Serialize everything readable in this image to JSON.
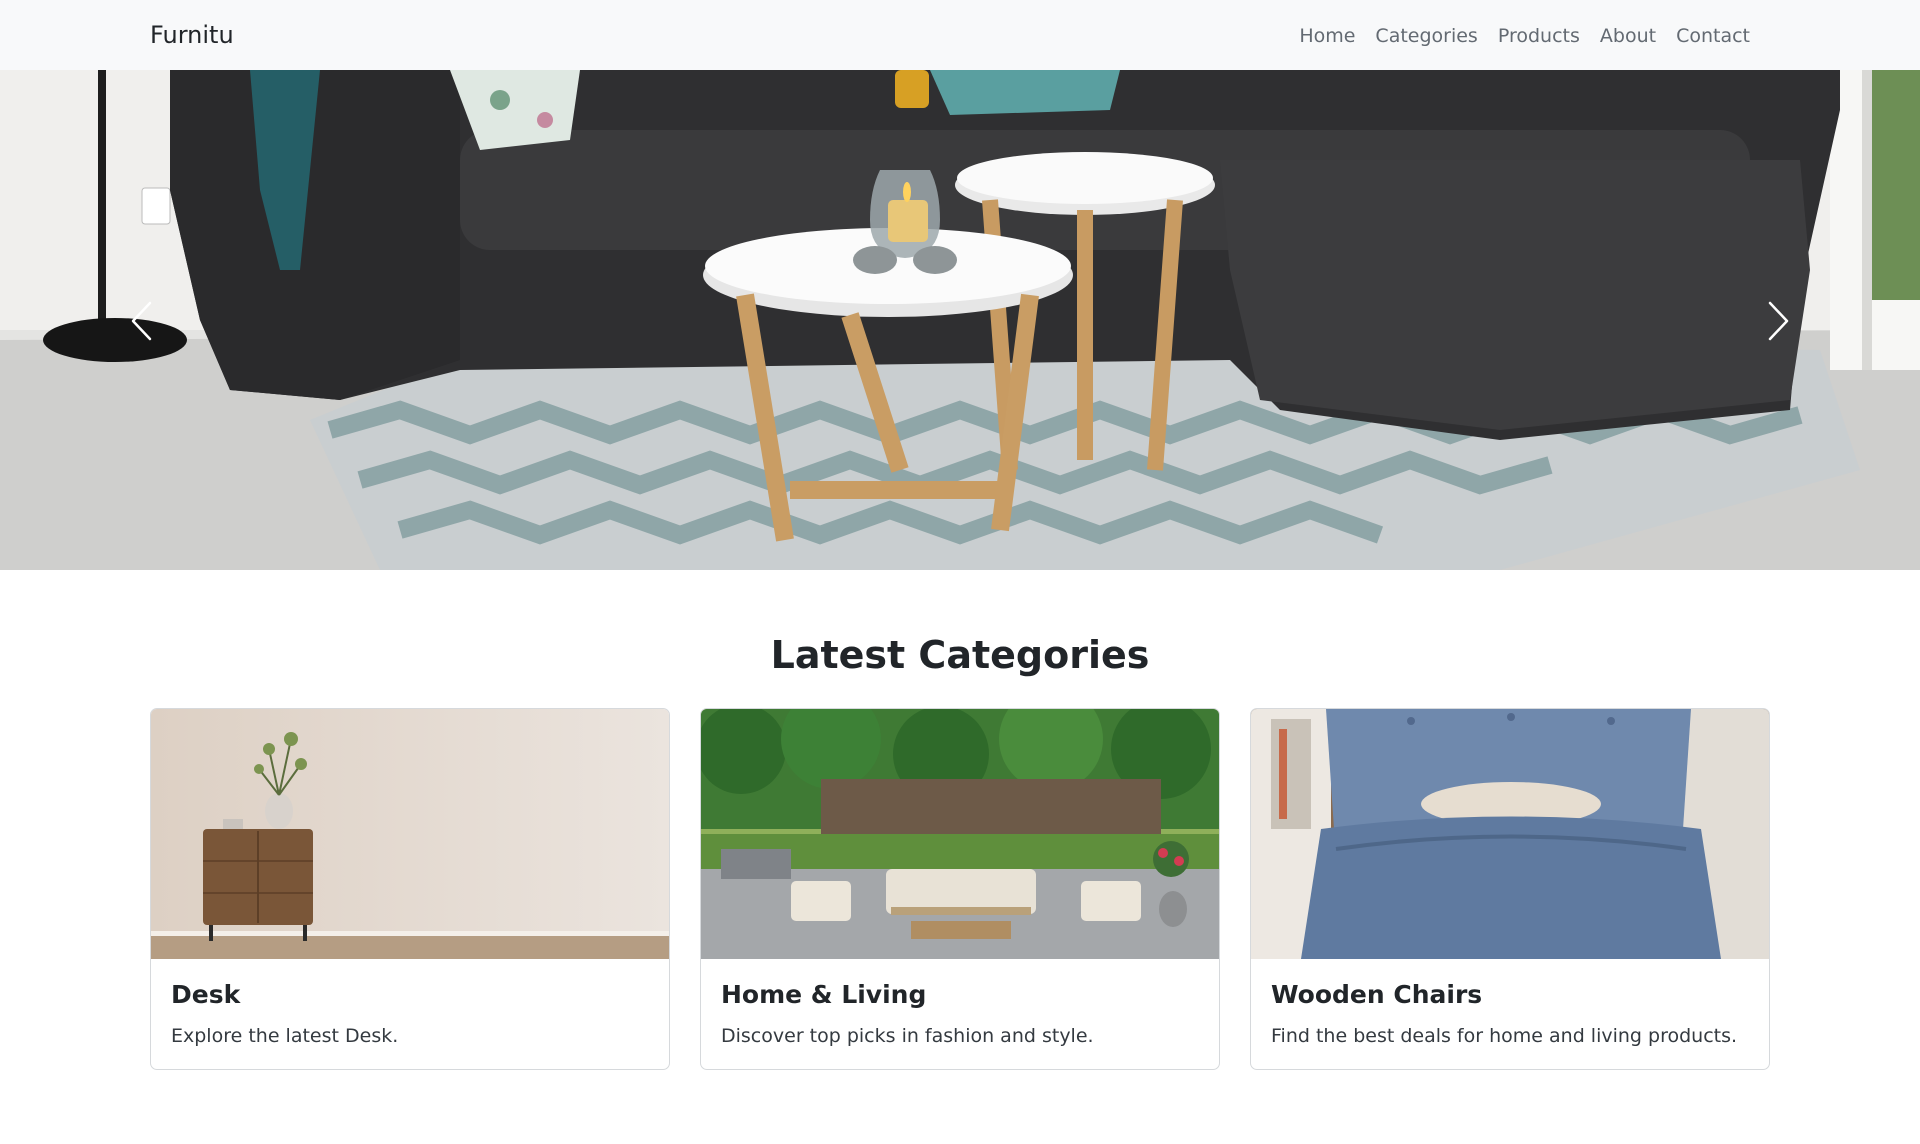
{
  "navbar": {
    "brand": "Furnitu",
    "links": [
      "Home",
      "Categories",
      "Products",
      "About",
      "Contact"
    ]
  },
  "hero": {
    "prev_icon": "chevron-left-icon",
    "next_icon": "chevron-right-icon"
  },
  "section": {
    "title": "Latest Categories"
  },
  "cards": [
    {
      "title": "Desk",
      "text": "Explore the latest Desk."
    },
    {
      "title": "Home & Living",
      "text": "Discover top picks in fashion and style."
    },
    {
      "title": "Wooden Chairs",
      "text": "Find the best deals for home and living products."
    }
  ]
}
